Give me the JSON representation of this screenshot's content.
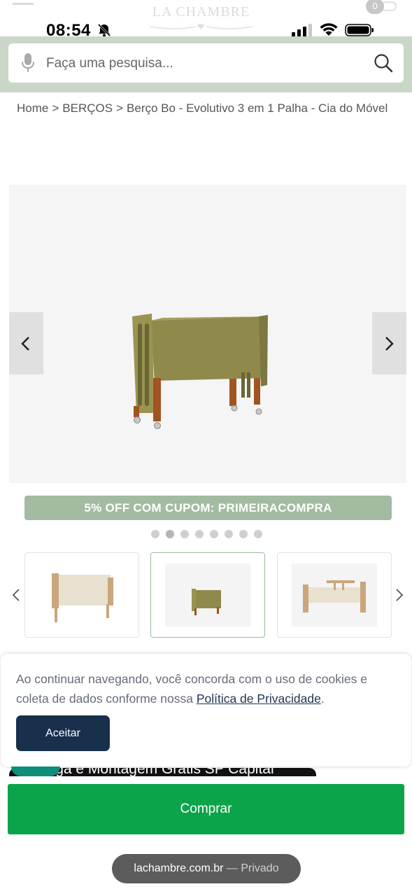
{
  "status_bar": {
    "time": "08:54",
    "icons": [
      "bell-slash-icon",
      "cell-signal-icon",
      "wifi-icon",
      "battery-icon"
    ]
  },
  "header": {
    "logo_text": "LA CHAMBRE",
    "cart_count": "0"
  },
  "search": {
    "placeholder": "Faça uma pesquisa...",
    "value": ""
  },
  "breadcrumb": {
    "items": [
      "Home",
      "BERÇOS",
      "Berço Bo - Evolutivo 3 em 1 Palha - Cia do Móvel"
    ],
    "separator": ">"
  },
  "gallery": {
    "coupon_text": "5% OFF COM CUPOM: PRIMEIRACOMPRA",
    "dot_count": 8,
    "active_dot": 1,
    "thumbnails": 3,
    "selected_thumbnail": 1
  },
  "cookie": {
    "text_before": "Ao continuar navegando, você concorda com o uso de cookies e coleta de dados conforme nossa ",
    "link_text": "Política de Privacidade",
    "text_after": ".",
    "accept_label": "Aceitar"
  },
  "shipping_strip": {
    "text": "Entrega e Montagem Grátis SP Capital"
  },
  "buy": {
    "label": "Comprar"
  },
  "browser": {
    "host": "lachambre.com.br",
    "mode": "— Privado"
  },
  "colors": {
    "brand_green": "#a2bba1",
    "search_band": "#c9d6c8",
    "buy_green": "#0ca44a",
    "accept_navy": "#18304c",
    "crib_olive": "#8f8a4b",
    "crib_wood": "#a0541f"
  }
}
